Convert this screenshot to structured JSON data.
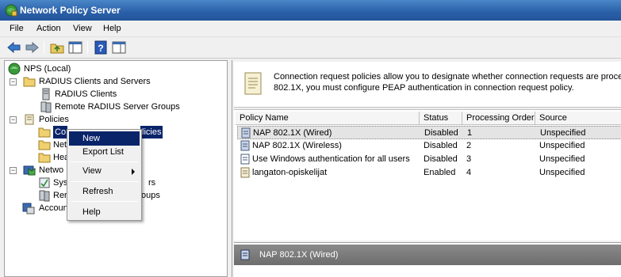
{
  "window": {
    "title": "Network Policy Server"
  },
  "menu": [
    "File",
    "Action",
    "View",
    "Help"
  ],
  "tree": {
    "root": "NPS (Local)",
    "radius_group": "RADIUS Clients and Servers",
    "radius_clients": "RADIUS Clients",
    "remote_groups": "Remote RADIUS Server Groups",
    "policies": "Policies",
    "conn_req_visible": "Co",
    "conn_req_tail": "licies",
    "net_policies_visible": "Net",
    "health_policies_visible": "Hea",
    "nap_visible": "Netwo",
    "nap_sys_visible": "Sys",
    "nap_sys_tail": "rs",
    "nap_rem_visible": "Rer",
    "nap_rem_tail": "oups",
    "accounting_visible": "Accoun"
  },
  "context_menu": {
    "items": [
      "New",
      "Export List",
      "View",
      "Refresh",
      "Help"
    ]
  },
  "description": {
    "line1": "Connection request policies allow you to designate whether connection requests are processe",
    "line2": "802.1X, you must configure PEAP authentication in connection request policy."
  },
  "table": {
    "columns": [
      "Policy Name",
      "Status",
      "Processing Order",
      "Source"
    ],
    "rows": [
      {
        "name": "NAP 802.1X (Wired)",
        "status": "Disabled",
        "order": "1",
        "source": "Unspecified"
      },
      {
        "name": "NAP 802.1X (Wireless)",
        "status": "Disabled",
        "order": "2",
        "source": "Unspecified"
      },
      {
        "name": "Use Windows authentication for all users",
        "status": "Disabled",
        "order": "3",
        "source": "Unspecified"
      },
      {
        "name": "langaton-opiskelijat",
        "status": "Enabled",
        "order": "4",
        "source": "Unspecified"
      }
    ]
  },
  "detail": {
    "title": "NAP 802.1X (Wired)"
  },
  "colors": {
    "title_bar": "#2a5fa8",
    "selection": "#0a246a",
    "detail_bar": "#7a7a7a"
  }
}
